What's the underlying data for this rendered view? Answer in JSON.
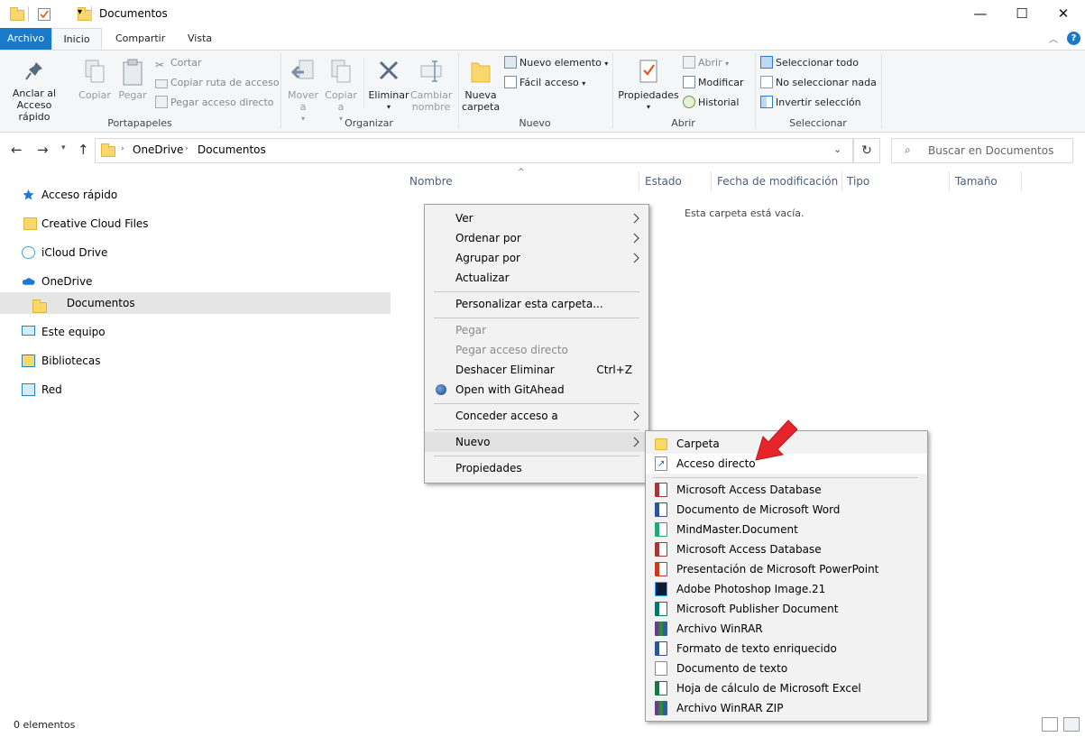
{
  "window": {
    "title": "Documentos",
    "minimize": "—",
    "maximize": "☐",
    "close": "✕"
  },
  "tabs": {
    "file": "Archivo",
    "home": "Inicio",
    "share": "Compartir",
    "view": "Vista"
  },
  "ribbon": {
    "clipboard": {
      "pin": "Anclar al Acceso rápido",
      "copy": "Copiar",
      "paste": "Pegar",
      "cut": "Cortar",
      "copy_path": "Copiar ruta de acceso",
      "paste_shortcut": "Pegar acceso directo",
      "label": "Portapapeles"
    },
    "organize": {
      "move": "Mover a",
      "copy": "Copiar a",
      "delete": "Eliminar",
      "rename": "Cambiar nombre",
      "label": "Organizar"
    },
    "new": {
      "new_folder": "Nueva carpeta",
      "new_item": "Nuevo elemento",
      "easy_access": "Fácil acceso",
      "label": "Nuevo"
    },
    "open": {
      "properties": "Propiedades",
      "open": "Abrir",
      "edit": "Modificar",
      "history": "Historial",
      "label": "Abrir"
    },
    "select": {
      "all": "Seleccionar todo",
      "none": "No seleccionar nada",
      "invert": "Invertir selección",
      "label": "Seleccionar"
    }
  },
  "address": {
    "crumbs": [
      "OneDrive",
      "Documentos"
    ],
    "search_placeholder": "Buscar en Documentos"
  },
  "nav": {
    "items": [
      "Acceso rápido",
      "Creative Cloud Files",
      "iCloud Drive",
      "OneDrive",
      "Documentos",
      "Este equipo",
      "Bibliotecas",
      "Red"
    ]
  },
  "columns": [
    "Nombre",
    "Estado",
    "Fecha de modificación",
    "Tipo",
    "Tamaño"
  ],
  "empty_message": "Esta carpeta está vacía.",
  "context_menu": {
    "items": [
      "Ver",
      "Ordenar por",
      "Agrupar por",
      "Actualizar",
      "Personalizar esta carpeta...",
      "Pegar",
      "Pegar acceso directo",
      "Deshacer Eliminar",
      "Open with GitAhead",
      "Conceder acceso a",
      "Nuevo",
      "Propiedades"
    ],
    "undo_shortcut": "Ctrl+Z"
  },
  "submenu": {
    "items": [
      "Carpeta",
      "Acceso directo",
      "Microsoft Access Database",
      "Documento de Microsoft Word",
      "MindMaster.Document",
      "Microsoft Access Database",
      "Presentación de Microsoft PowerPoint",
      "Adobe Photoshop Image.21",
      "Microsoft Publisher Document",
      "Archivo WinRAR",
      "Formato de texto enriquecido",
      "Documento de texto",
      "Hoja de cálculo de Microsoft Excel",
      "Archivo WinRAR ZIP"
    ]
  },
  "status": {
    "count": "0 elementos"
  },
  "colors": {
    "accent": "#1979ca",
    "arrow": "#e8242b",
    "selection": "#e5e5e5"
  }
}
